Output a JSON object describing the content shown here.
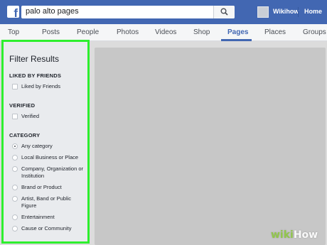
{
  "topbar": {
    "search_value": "palo alto pages",
    "user_name": "Wikihow",
    "home_label": "Home"
  },
  "tabs": [
    {
      "label": "Top"
    },
    {
      "label": "Posts"
    },
    {
      "label": "People"
    },
    {
      "label": "Photos"
    },
    {
      "label": "Videos"
    },
    {
      "label": "Shop"
    },
    {
      "label": "Pages",
      "active": true
    },
    {
      "label": "Places"
    },
    {
      "label": "Groups"
    }
  ],
  "filter": {
    "title": "Filter Results",
    "sections": [
      {
        "heading": "LIKED BY FRIENDS",
        "options": [
          {
            "label": "Liked by Friends",
            "checked": false
          }
        ]
      },
      {
        "heading": "VERIFIED",
        "options": [
          {
            "label": "Verified",
            "checked": false
          }
        ]
      },
      {
        "heading": "CATEGORY",
        "options": [
          {
            "label": "Any category",
            "selected": true
          },
          {
            "label": "Local Business or Place",
            "selected": false
          },
          {
            "label": "Company, Organization or Institution",
            "selected": false
          },
          {
            "label": "Brand or Product",
            "selected": false
          },
          {
            "label": "Artist, Band or Public Figure",
            "selected": false
          },
          {
            "label": "Entertainment",
            "selected": false
          },
          {
            "label": "Cause or Community",
            "selected": false
          }
        ]
      }
    ]
  },
  "watermark": {
    "wiki": "wiki",
    "how": "How"
  },
  "colors": {
    "brand": "#4267b2",
    "highlight": "#2eef2e"
  }
}
